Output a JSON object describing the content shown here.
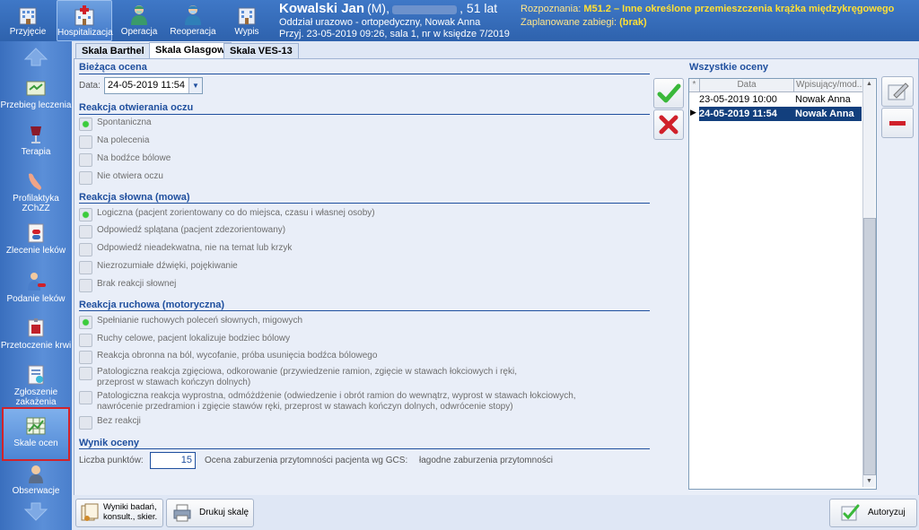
{
  "top_toolbar": {
    "buttons": [
      {
        "label": "Przyjęcie",
        "icon": "building-icon",
        "active": false
      },
      {
        "label": "Hospitalizacja",
        "icon": "hospital-icon",
        "active": true
      },
      {
        "label": "Operacja",
        "icon": "surgeon-icon",
        "active": false
      },
      {
        "label": "Reoperacja",
        "icon": "reoperation-icon",
        "active": false
      },
      {
        "label": "Wypis",
        "icon": "discharge-building-icon",
        "active": false
      }
    ]
  },
  "patient": {
    "name": "Kowalski Jan",
    "sex": "(M),",
    "age": ", 51 lat",
    "ward": "Oddział urazowo - ortopedyczny, Nowak Anna",
    "admission": "Przyj. 23-05-2019 09:26, sala 1, nr w księdze 7/2019"
  },
  "diagnosis": {
    "label": "Rozpoznania:",
    "code": "M51.2 – Inne określone przemieszczenia krążka międzykręgowego",
    "planned_label": "Zaplanowane zabiegi:",
    "planned_value": "(brak)"
  },
  "sidebar": {
    "items": [
      {
        "label": "Przebieg leczenia",
        "icon": "treatment-course-icon"
      },
      {
        "label": "Terapia",
        "icon": "therapy-icon"
      },
      {
        "label": "Profilaktyka ZChZZ",
        "icon": "prophylaxis-icon"
      },
      {
        "label": "Zlecenie leków",
        "icon": "drug-order-icon"
      },
      {
        "label": "Podanie leków",
        "icon": "drug-administration-icon"
      },
      {
        "label": "Przetoczenie krwi",
        "icon": "blood-transfusion-icon"
      },
      {
        "label": "Zgłoszenie zakażenia",
        "icon": "infection-report-icon"
      },
      {
        "label": "Skale ocen",
        "icon": "scales-grid-icon",
        "selected": true
      },
      {
        "label": "Obserwacje",
        "icon": "observations-icon"
      }
    ]
  },
  "tabs": [
    {
      "label": "Skala Barthel"
    },
    {
      "label": "Skala Glasgow",
      "active": true
    },
    {
      "label": "Skala VES-13"
    }
  ],
  "current": {
    "title": "Bieżąca ocena",
    "date_label": "Data:",
    "date_value": "24-05-2019 11:54"
  },
  "eye": {
    "title": "Reakcja otwierania oczu",
    "options": [
      "Spontaniczna",
      "Na polecenia",
      "Na bodźce bólowe",
      "Nie otwiera oczu"
    ],
    "selected": 0
  },
  "verbal": {
    "title": "Reakcja słowna (mowa)",
    "options": [
      "Logiczna (pacjent zorientowany co do miejsca, czasu i własnej osoby)",
      "Odpowiedź splątana (pacjent zdezorientowany)",
      "Odpowiedź nieadekwatna, nie na temat lub krzyk",
      "Niezrozumiałe dźwięki, pojękiwanie",
      "Brak reakcji słownej"
    ],
    "selected": 0
  },
  "motor": {
    "title": "Reakcja ruchowa (motoryczna)",
    "options": [
      "Spełnianie ruchowych poleceń słownych, migowych",
      "Ruchy celowe, pacjent lokalizuje bodziec bólowy",
      "Reakcja obronna na ból, wycofanie, próba usunięcia bodźca bólowego",
      "Patologiczna reakcja zgięciowa, odkorowanie (przywiedzenie ramion, zgięcie w stawach łokciowych i ręki, przeprost w stawach kończyn dolnych)",
      "Patologiczna reakcja wyprostna, odmóżdżenie (odwiedzenie i obrót ramion do wewnątrz, wyprost w stawach łokciowych, nawrócenie przedramion i zgięcie stawów ręki, przeprost w stawach kończyn dolnych, odwrócenie stopy)",
      "Bez reakcji"
    ],
    "selected": 0
  },
  "result": {
    "title": "Wynik oceny",
    "points_label": "Liczba punktów:",
    "points_value": "15",
    "gcs_label": "Ocena zaburzenia przytomności pacjenta wg GCS:",
    "gcs_value": "łagodne zaburzenia przytomności"
  },
  "all_scores": {
    "title": "Wszystkie oceny",
    "col_marker": "*",
    "col_date": "Data",
    "col_user": "Wpisujący/mod...",
    "rows": [
      {
        "date": "23-05-2019 10:00",
        "user": "Nowak Anna",
        "selected": false
      },
      {
        "date": "24-05-2019 11:54",
        "user": "Nowak Anna",
        "selected": true
      }
    ]
  },
  "bottom": {
    "results_label": "Wyniki badań, konsult., skier.",
    "print_label": "Drukuj skalę",
    "authorize_label": "Autoryzuj"
  },
  "colors": {
    "accent": "#1f4f9e",
    "selected_row": "#123f7d",
    "highlight": "#ffe034",
    "ok_green": "#3ab83a",
    "cancel_red": "#d0202a"
  }
}
